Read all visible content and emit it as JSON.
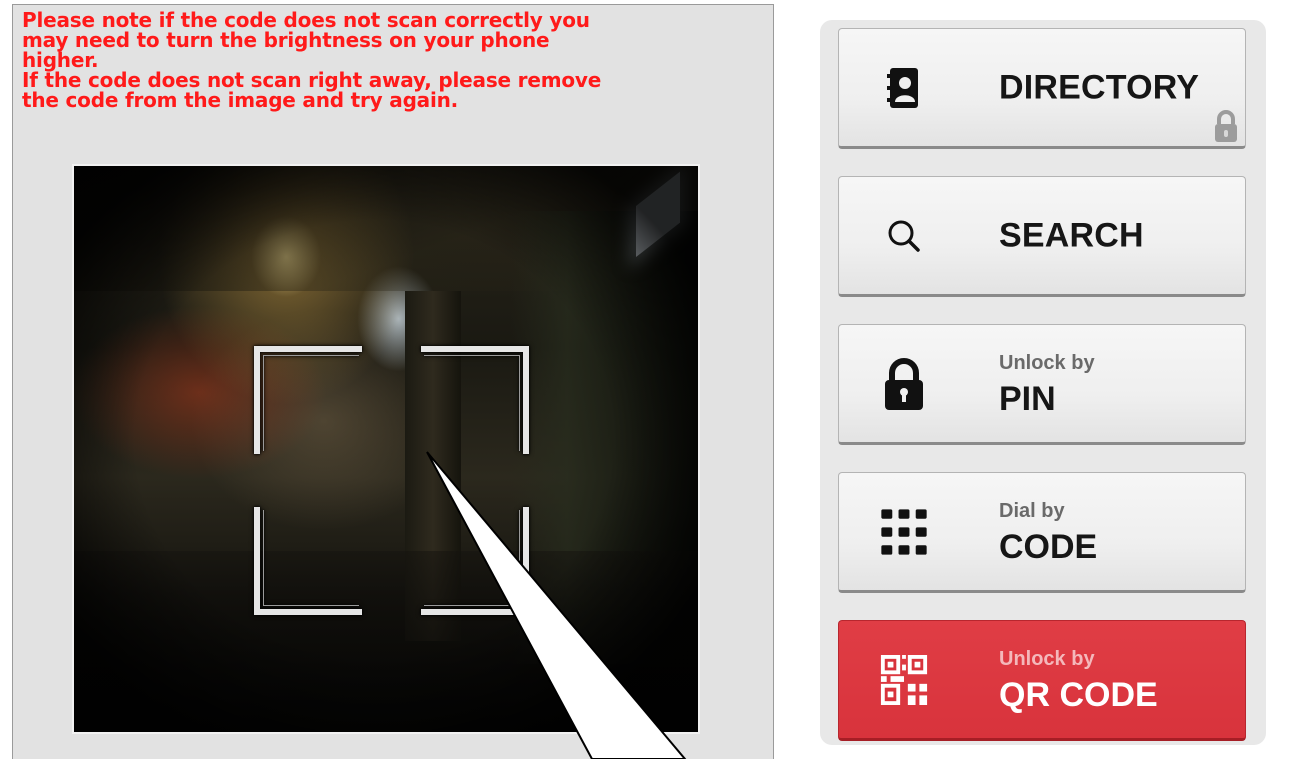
{
  "notice": {
    "lines": [
      "Please note if the code does not scan correctly you",
      "may need to turn the brightness on your phone",
      "higher.",
      "If the code does not scan right away, please remove",
      "the code from the image and try again."
    ],
    "color": "#ff1a1a"
  },
  "camera": {
    "feed_icon": "camera-feed",
    "scan_frame_icon": "qr-scan-frame-brackets"
  },
  "menu": {
    "directory": {
      "label": "DIRECTORY",
      "icon": "address-book-icon",
      "badge_icon": "lock-icon"
    },
    "search": {
      "label": "SEARCH",
      "icon": "search-icon"
    },
    "pin": {
      "sub": "Unlock by",
      "label": "PIN",
      "icon": "padlock-icon"
    },
    "code": {
      "sub": "Dial by",
      "label": "CODE",
      "icon": "keypad-icon"
    },
    "qr": {
      "sub": "Unlock by",
      "label": "QR CODE",
      "icon": "qr-code-icon",
      "active": true
    }
  },
  "colors": {
    "accent": "#d8333c",
    "notice_text": "#ff1a1a",
    "panel_bg": "#e2e2e2"
  }
}
